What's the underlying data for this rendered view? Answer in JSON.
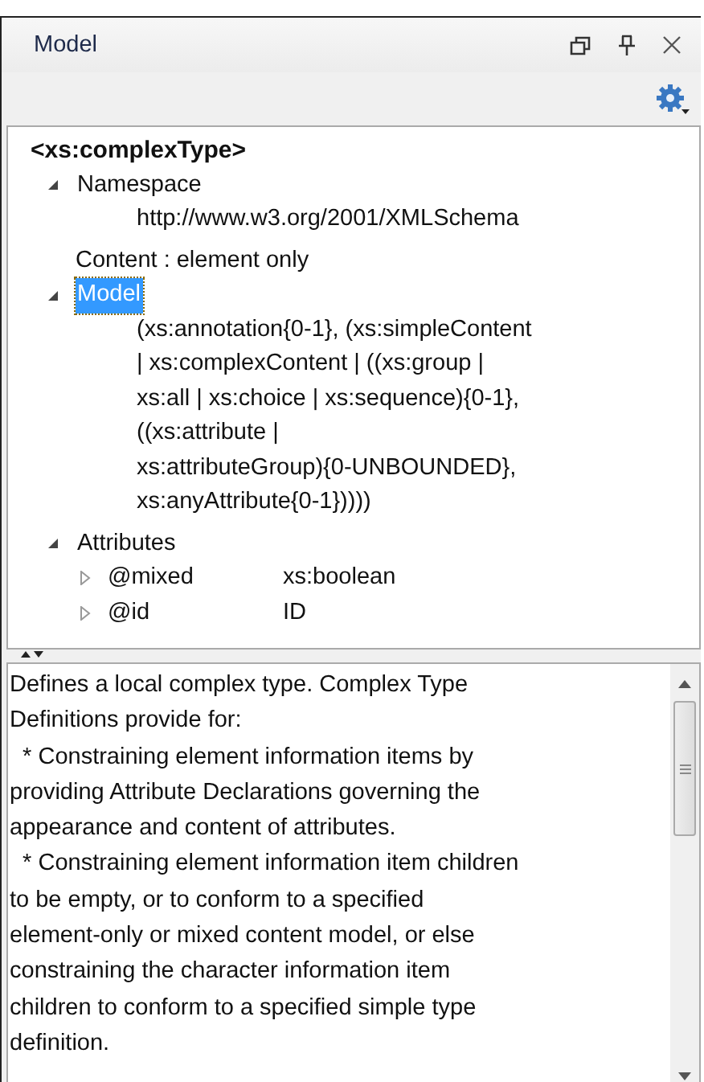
{
  "window": {
    "title": "Model"
  },
  "tree": {
    "root": "<xs:complexType>",
    "items": [
      {
        "kind": "group",
        "label": "Namespace",
        "expanded": true,
        "selected": false,
        "children": [
          {
            "kind": "text",
            "label": "http://www.w3.org/2001/XMLSchema"
          }
        ]
      },
      {
        "kind": "text",
        "label": "Content : element only"
      },
      {
        "kind": "group",
        "label": "Model",
        "expanded": true,
        "selected": true,
        "children": [
          {
            "kind": "text",
            "label": "(xs:annotation{0-1}, (xs:simpleContent\n| xs:complexContent | ((xs:group |\nxs:all | xs:choice | xs:sequence){0-1},\n((xs:attribute |\nxs:attributeGroup){0-UNBOUNDED},\nxs:anyAttribute{0-1}))))"
          }
        ]
      },
      {
        "kind": "group",
        "label": "Attributes",
        "expanded": true,
        "selected": false,
        "children": [
          {
            "kind": "attribute",
            "name": "@mixed",
            "type": "xs:boolean",
            "expanded": false
          },
          {
            "kind": "attribute",
            "name": "@id",
            "type": "ID",
            "expanded": false
          }
        ]
      }
    ]
  },
  "description": "Defines a local complex type. Complex Type\nDefinitions provide for:\n  * Constraining element information items by\nproviding Attribute Declarations governing the\nappearance and content of attributes.\n  * Constraining element information item children\nto be empty, or to conform to a specified\nelement-only or mixed content model, or else\nconstraining the character information item\nchildren to conform to a specified simple type\ndefinition."
}
